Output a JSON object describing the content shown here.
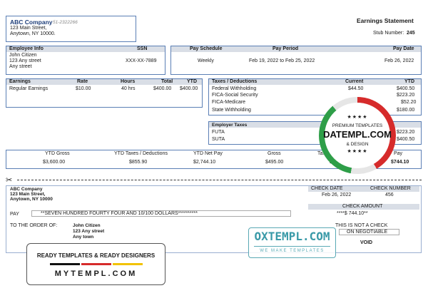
{
  "company": {
    "name": "ABC Company",
    "id": "51-2322266",
    "street": "123 Main Street,",
    "city": "Anytown, NY 10000."
  },
  "statement": {
    "title": "Earnings Statement",
    "stub_label": "Stub Number:",
    "stub_number": "245"
  },
  "employee": {
    "header": "Employee Info",
    "ssn_header": "SSN",
    "name": "John Citizen",
    "street": "123 Any street",
    "city": "Any street",
    "ssn": "XXX-XX-7889"
  },
  "pay": {
    "schedule_header": "Pay Schedule",
    "period_header": "Pay Period",
    "date_header": "Pay Date",
    "schedule": "Weekly",
    "period": "Feb 19, 2022 to Feb 25, 2022",
    "date": "Feb 26, 2022"
  },
  "earnings": {
    "headers": [
      "Earnings",
      "Rate",
      "Hours",
      "Total",
      "YTD"
    ],
    "row": [
      "Regular Earnings",
      "$10.00",
      "40 hrs",
      "$400.00",
      "$400.00"
    ]
  },
  "deductions": {
    "headers": [
      "Taxes / Deductions",
      "Current",
      "YTD"
    ],
    "rows": [
      [
        "Federal Withholding",
        "$44.50",
        "$400.50"
      ],
      [
        "FICA-Social Security",
        "",
        "$223.20"
      ],
      [
        "FICA-Medicare",
        "",
        "$52.20"
      ],
      [
        "State Withholding",
        "",
        "$180.00"
      ]
    ]
  },
  "employer_taxes": {
    "header": "Employer Taxes",
    "rows": [
      [
        "FUTA",
        "",
        "$223.20"
      ],
      [
        "SUTA",
        "",
        "$400.50"
      ]
    ]
  },
  "ytd": {
    "headers": [
      "YTD Gross",
      "YTD Taxes / Deductions",
      "YTD Net Pay",
      "Gross",
      "Taxes",
      "Net Pay"
    ],
    "values": [
      "$3,600.00",
      "$855.90",
      "$2,744.10",
      "$495.00",
      "$4",
      "$744.10"
    ],
    "visible_headers": [
      "YTD Gross",
      "YTD Taxes / Deductions",
      "YTD Net Pay",
      "Gross",
      "Taxe",
      "Pay"
    ]
  },
  "check": {
    "company": "ABC Company",
    "street": "123 Main Street,",
    "city": "Anytown, NY 10000",
    "date_header": "CHECK DATE",
    "number_header": "CHECK NUMBER",
    "date": "Feb 26, 2022",
    "number": "456",
    "amount_header": "CHECK AMOUNT",
    "amount": "****$ 744.10**",
    "pay_label": "PAY",
    "pay_words": "**SEVEN HUNDRED FOURTY  FOUR AND 10/100 DOLLARS**********",
    "order_label": "TO THE ORDER OF:",
    "payee_name": "John Citizen",
    "payee_street": "123 Any street",
    "payee_city": "Any town",
    "not_check": "THIS IS NOT A CHECK",
    "non_negotiable": "ON NEGOTIABLE",
    "void": "VOID"
  },
  "badge": {
    "stars": "★★★★",
    "line1": "PREMIUM TEMPLATES",
    "brand": "DATEMPL.COM",
    "line2": "& DESIGN",
    "stars2": "★★★★"
  },
  "oxtempl": {
    "brand": "OXTEMPL.COM",
    "tagline": "WE MAKE TEMPLATES"
  },
  "mytempl": {
    "line1": "READY TEMPLATES & READY DESIGNERS",
    "brand": "MYTEMPL.COM"
  },
  "colors": {
    "border": "#5b7fb5",
    "green": "#2e9e48",
    "red": "#d62b2b"
  }
}
